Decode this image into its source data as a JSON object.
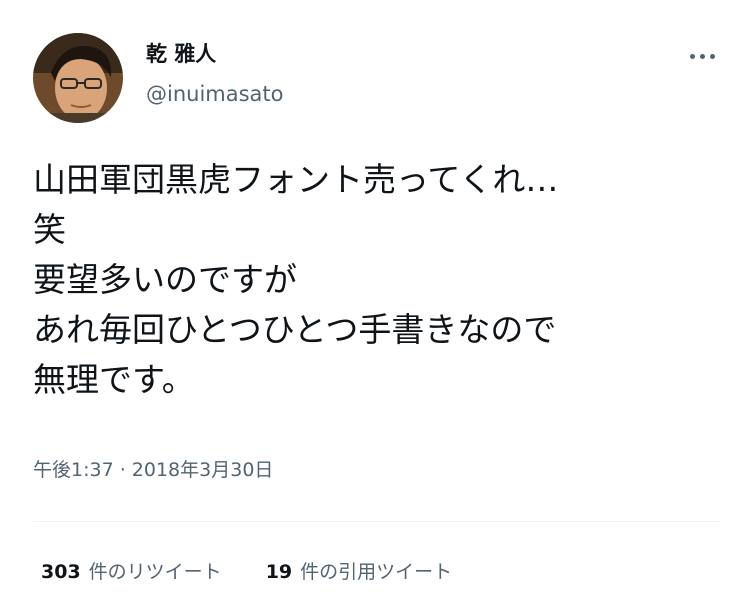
{
  "author": {
    "display_name": "乾 雅人",
    "handle": "@inuimasato"
  },
  "tweet": {
    "lines": [
      "山田軍団黒虎フォント売ってくれ…",
      "笑",
      "要望多いのですが",
      "あれ毎回ひとつひとつ手書きなので",
      "無理です。"
    ],
    "timestamp": "午後1:37 · 2018年3月30日"
  },
  "stats": {
    "retweets": {
      "count": "303",
      "label": "件のリツイート"
    },
    "quotes": {
      "count": "19",
      "label": "件の引用ツイート"
    }
  },
  "icons": {
    "more": "more-horizontal-icon",
    "avatar": "avatar-photo"
  },
  "colors": {
    "text_primary": "#0f1419",
    "text_secondary": "#536471",
    "divider": "#eff3f4"
  }
}
